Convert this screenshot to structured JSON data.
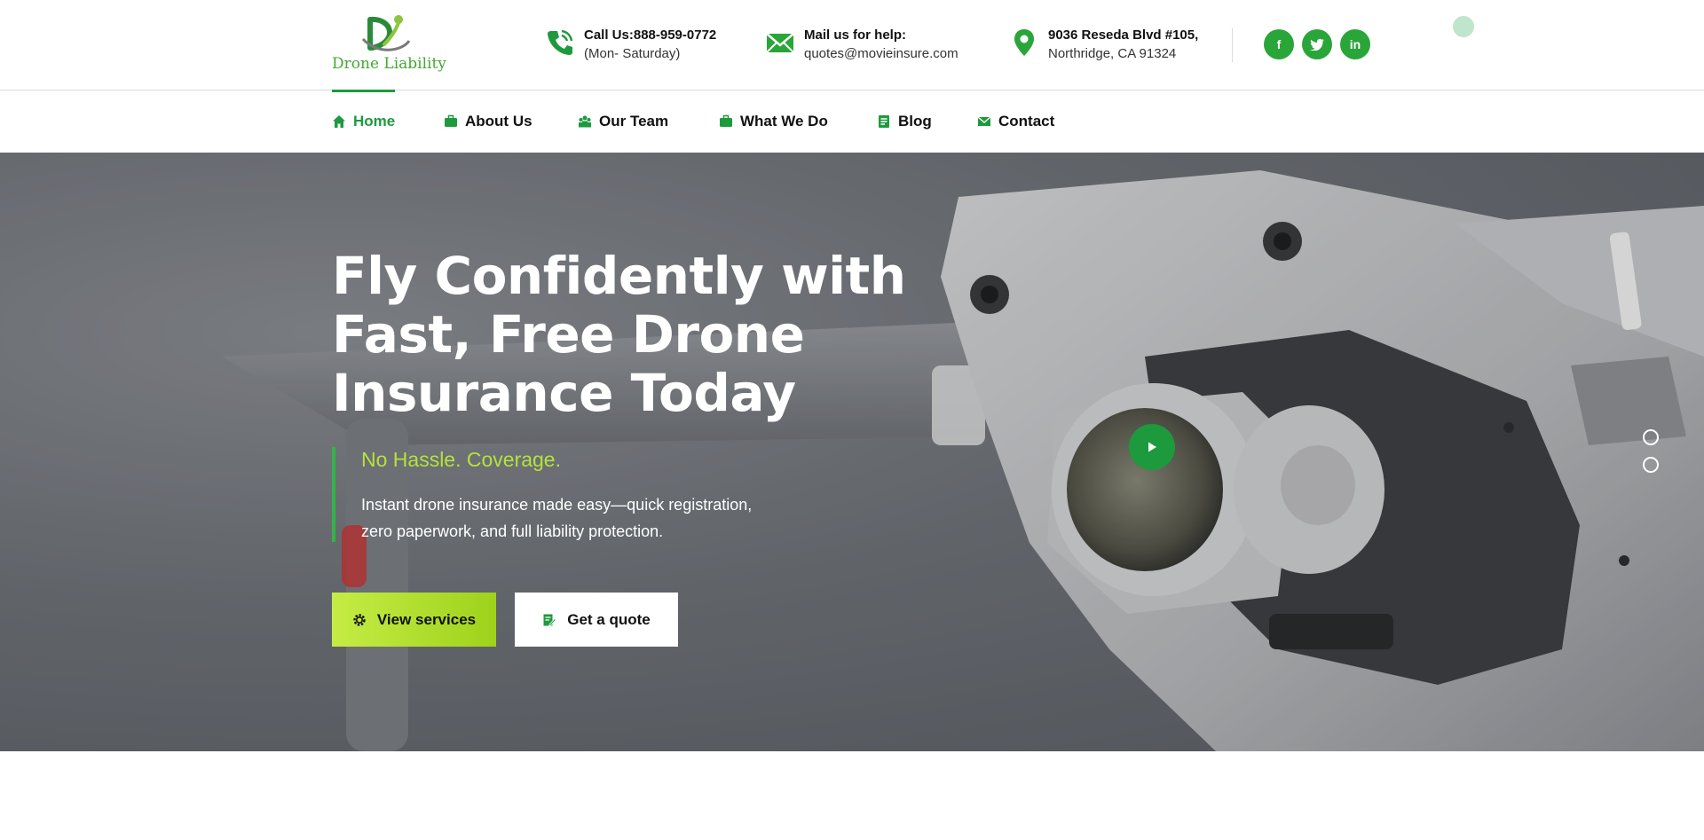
{
  "brand": {
    "name": "Drone Liability"
  },
  "contact": {
    "phone_label": "Call Us:888-959-0772",
    "phone_hours": "(Mon- Saturday)",
    "mail_label": "Mail us for help:",
    "mail_value": "quotes@movieinsure.com",
    "address_line1": "9036 Reseda Blvd #105,",
    "address_line2": "Northridge, CA 91324"
  },
  "socials": [
    {
      "name": "facebook",
      "glyph": "f"
    },
    {
      "name": "twitter",
      "glyph": "t"
    },
    {
      "name": "linkedin",
      "glyph": "in"
    }
  ],
  "nav": {
    "items": [
      {
        "label": "Home",
        "icon": "home-icon",
        "active": true
      },
      {
        "label": "About Us",
        "icon": "briefcase-icon"
      },
      {
        "label": "Our Team",
        "icon": "team-icon"
      },
      {
        "label": "What We Do",
        "icon": "briefcase-icon"
      },
      {
        "label": "Blog",
        "icon": "document-icon"
      },
      {
        "label": "Contact",
        "icon": "envelope-icon"
      }
    ]
  },
  "hero": {
    "title_lines": [
      "Fly Confidently with",
      "Fast, Free Drone",
      "Insurance Today"
    ],
    "subtitle": "No Hassle. Coverage.",
    "description_lines": [
      "Instant drone insurance made easy—quick registration,",
      "zero paperwork, and full liability protection."
    ],
    "primary_button": "View services",
    "secondary_button": "Get a quote"
  },
  "colors": {
    "brand_green": "#1e9a3e",
    "lime": "#b6e23a",
    "social_green": "#2aa53a"
  }
}
